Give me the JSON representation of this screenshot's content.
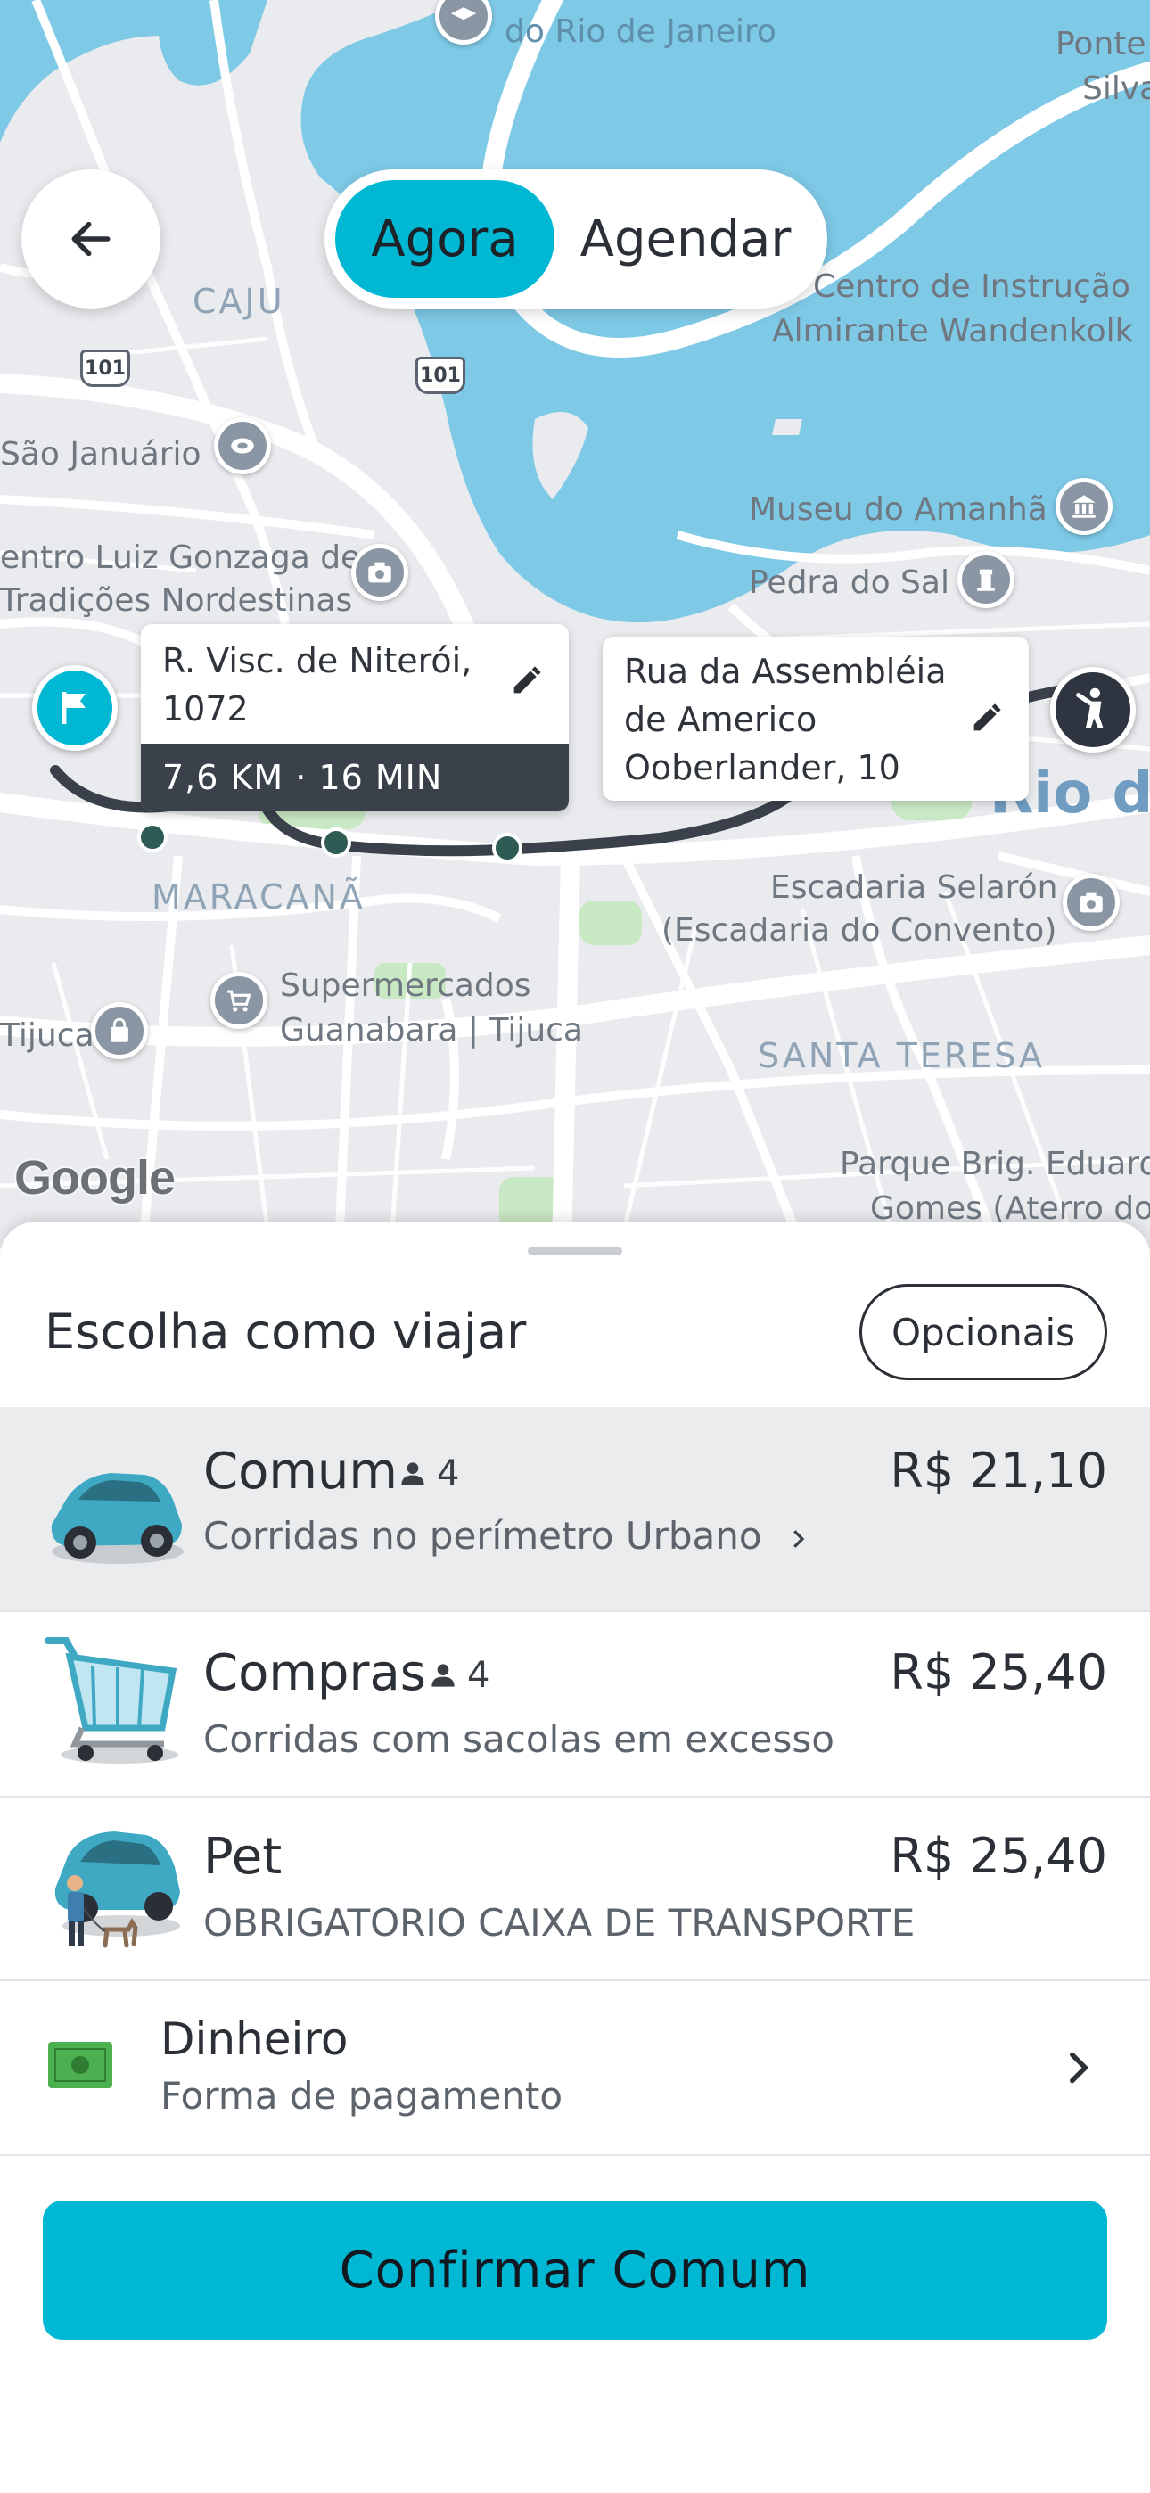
{
  "colors": {
    "accent": "#00b8d4",
    "water": "#7ec9e6",
    "route": "#3a414b",
    "cash": "#4caf50"
  },
  "map": {
    "labels": {
      "rio_de_janeiro": "do Rio de Janeiro",
      "ponte": "Ponte",
      "silva": "Silva",
      "caju": "CAJU",
      "centro_instrucao_1": "Centro de Instrução",
      "centro_instrucao_2": "Almirante Wandenkolk",
      "sao_januario": "São Januário",
      "museu": "Museu do Amanhã",
      "luiz_gonzaga_1": "entro Luiz Gonzaga de",
      "luiz_gonzaga_2": "Tradições Nordestinas",
      "pedra_do_sal": "Pedra do Sal",
      "rio_de": "Rio de",
      "maracana": "MARACANÃ",
      "escadaria_1": "Escadaria Selarón",
      "escadaria_2": "(Escadaria do Convento)",
      "supermercados_1": "Supermercados",
      "supermercados_2": "Guanabara | Tijuca",
      "tijuca": "Tijuca",
      "santa_teresa": "SANTA TERESA",
      "parque_1": "Parque Brig. Eduard",
      "parque_2": "Gomes (Aterro do",
      "shield": "101",
      "google": "Google"
    },
    "origin": {
      "address_line1": "R. Visc. de Niterói,",
      "address_line2": "1072",
      "route_info": "7,6 KM · 16 MIN"
    },
    "destination": {
      "address_line1": "Rua da Assembléia",
      "address_line2": "de Americo",
      "address_line3": "Ooberlander, 10"
    }
  },
  "mode_toggle": {
    "now_label": "Agora",
    "schedule_label": "Agendar",
    "selected": "Agora"
  },
  "sheet": {
    "title": "Escolha como viajar",
    "options_button": "Opcionais",
    "rides": [
      {
        "name": "Comum",
        "passengers": "4",
        "description": "Corridas no perímetro Urbano",
        "price": "R$ 21,10",
        "selected": true
      },
      {
        "name": "Compras",
        "passengers": "4",
        "description": "Corridas com sacolas em excesso",
        "price": "R$ 25,40",
        "selected": false
      },
      {
        "name": "Pet",
        "passengers": "",
        "description": "OBRIGATORIO CAIXA DE TRANSPORTE",
        "price": "R$ 25,40",
        "selected": false
      }
    ],
    "payment": {
      "method": "Dinheiro",
      "label": "Forma de pagamento"
    },
    "confirm_button": "Confirmar Comum"
  }
}
